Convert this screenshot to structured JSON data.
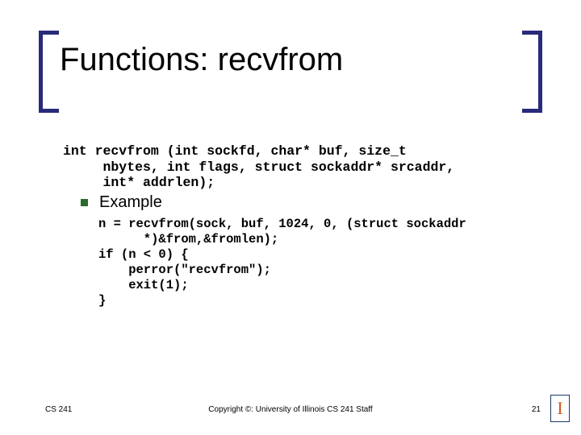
{
  "title": "Functions: recvfrom",
  "signature": {
    "l1": "int recvfrom (int sockfd, char* buf, size_t",
    "l2": "     nbytes, int flags, struct sockaddr* srcaddr,",
    "l3": "     int* addrlen);"
  },
  "example_label": "Example",
  "code": {
    "l1": "n = recvfrom(sock, buf, 1024, 0, (struct sockaddr",
    "l2": "      *)&from,&fromlen);",
    "l3": "if (n < 0) {",
    "l4": "    perror(\"recvfrom\");",
    "l5": "    exit(1);",
    "l6": "}"
  },
  "footer": {
    "left": "CS 241",
    "center": "Copyright ©: University of Illinois CS 241 Staff",
    "right": "21"
  },
  "logo_glyph": "I"
}
